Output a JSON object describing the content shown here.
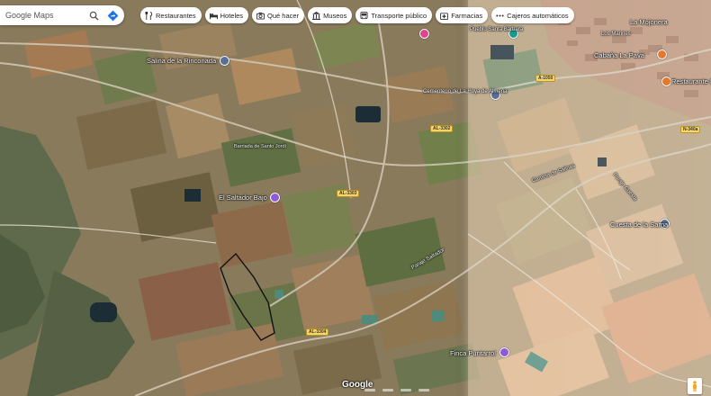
{
  "search": {
    "placeholder": "Google Maps"
  },
  "chips": [
    {
      "label": "Restaurantes",
      "icon": "fork-knife-icon"
    },
    {
      "label": "Hoteles",
      "icon": "bed-icon"
    },
    {
      "label": "Qué hacer",
      "icon": "camera-icon"
    },
    {
      "label": "Museos",
      "icon": "museum-icon"
    },
    {
      "label": "Transporte público",
      "icon": "bus-icon"
    },
    {
      "label": "Farmacias",
      "icon": "pharmacy-icon"
    },
    {
      "label": "Cajeros automáticos",
      "icon": "more-icon"
    }
  ],
  "places": [
    {
      "label": "Salina de la Rinconada"
    },
    {
      "label": "El Saltador Bajo"
    },
    {
      "label": "Finca Puntarrol"
    },
    {
      "label": "Pueblo Santa Bárbara"
    },
    {
      "label": "Cementerio de La Hoya de Almeria"
    },
    {
      "label": "Cuesta de la Sarna"
    },
    {
      "label": "Los Marines"
    },
    {
      "label": "Barriada de Santo Jordi"
    },
    {
      "label": "La Mojonera"
    },
    {
      "label": "Cabaña La Pava"
    },
    {
      "label": "Restaurante El Pa"
    }
  ],
  "roads": [
    {
      "label": "A-1050"
    },
    {
      "label": "AL-3302"
    },
    {
      "label": "AL-3303"
    },
    {
      "label": "AL-3304"
    },
    {
      "label": "N-340a"
    },
    {
      "label": "Paraje Saltador"
    },
    {
      "label": "Camino de Salinas"
    },
    {
      "label": "Paraje Cuesta"
    }
  ],
  "footer": {
    "logo": "Google"
  },
  "colors": {
    "poi_purple": "#8e5bd6",
    "poi_teal": "#1a9a8a",
    "poi_pink": "#e0448c",
    "poi_blue": "#5a6d93",
    "poi_orange": "#e37a2b"
  }
}
